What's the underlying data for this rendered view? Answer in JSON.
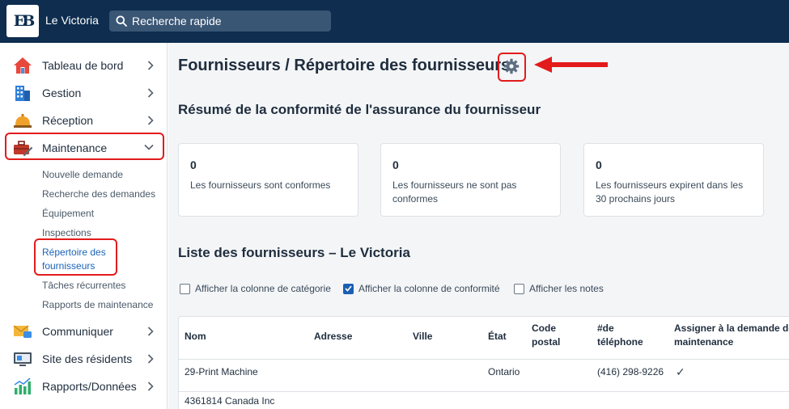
{
  "app": {
    "name": "Le Victoria",
    "logo_text": "EB"
  },
  "search": {
    "placeholder": "Recherche rapide"
  },
  "sidebar": {
    "items": [
      {
        "label": "Tableau de bord",
        "icon": "house-icon"
      },
      {
        "label": "Gestion",
        "icon": "building-icon"
      },
      {
        "label": "Réception",
        "icon": "bell-icon"
      },
      {
        "label": "Maintenance",
        "icon": "toolbox-icon"
      },
      {
        "label": "Communiquer",
        "icon": "envelope-icon"
      },
      {
        "label": "Site des résidents",
        "icon": "monitor-icon"
      },
      {
        "label": "Rapports/Données",
        "icon": "bar-chart-icon"
      }
    ],
    "maintenance_sub": [
      "Nouvelle demande",
      "Recherche des demandes",
      "Équipement",
      "Inspections",
      "Répertoire des fournisseurs",
      "Tâches récurrentes",
      "Rapports de maintenance"
    ]
  },
  "main": {
    "title": "Fournisseurs / Répertoire des fournisseurs",
    "summary_title": "Résumé de la conformité de l'assurance du fournisseur",
    "cards": [
      {
        "value": "0",
        "text": "Les fournisseurs sont conformes"
      },
      {
        "value": "0",
        "text": "Les fournisseurs ne sont pas conformes"
      },
      {
        "value": "0",
        "text": "Les fournisseurs expirent dans les 30 prochains jours"
      }
    ],
    "list_title": "Liste des fournisseurs – Le Victoria",
    "checkboxes": [
      {
        "label": "Afficher la colonne de catégorie",
        "checked": false
      },
      {
        "label": "Afficher la colonne de conformité",
        "checked": true
      },
      {
        "label": "Afficher les notes",
        "checked": false
      }
    ],
    "table": {
      "columns": [
        "Nom",
        "Adresse",
        "Ville",
        "État",
        "Code postal",
        "#de téléphone",
        "Assigner à la demande de maintenance"
      ],
      "rows": [
        {
          "nom": "29-Print Machine",
          "adresse": "",
          "ville": "",
          "etat": "Ontario",
          "code_postal": "",
          "telephone": "(416) 298-9226",
          "assign": "✓"
        },
        {
          "nom": "4361814 Canada Inc",
          "adresse": "",
          "ville": "",
          "etat": "",
          "code_postal": "",
          "telephone": "",
          "assign": ""
        }
      ]
    }
  },
  "colors": {
    "topbar": "#0e2d4f",
    "accent": "#1a5fb4",
    "highlight": "#e31b1b"
  }
}
